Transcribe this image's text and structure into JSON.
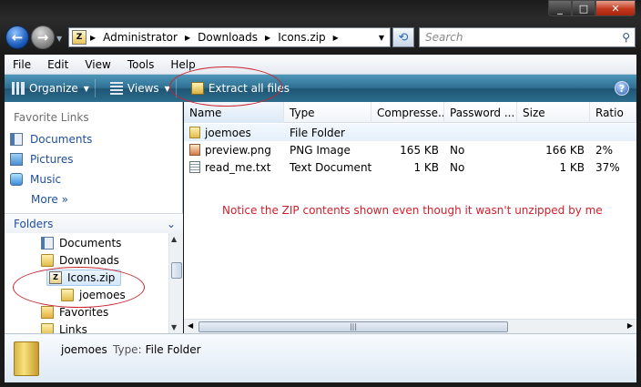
{
  "window": {
    "minimize": "_",
    "maximize": "□",
    "close": "✕"
  },
  "address": {
    "crumbs": [
      "Administrator",
      "Downloads",
      "Icons.zip"
    ],
    "search_placeholder": "Search"
  },
  "menu": [
    "File",
    "Edit",
    "View",
    "Tools",
    "Help"
  ],
  "commands": {
    "organize": "Organize",
    "views": "Views",
    "extract": "Extract all files",
    "help": "?"
  },
  "nav": {
    "favorite_title": "Favorite Links",
    "favorites": [
      "Documents",
      "Pictures",
      "Music"
    ],
    "more": "More",
    "folders_title": "Folders",
    "tree": [
      "Documents",
      "Downloads",
      "Icons.zip",
      "joemoes",
      "Favorites",
      "Links"
    ]
  },
  "columns": [
    "Name",
    "Type",
    "Compresse...",
    "Password ...",
    "Size",
    "Ratio"
  ],
  "files": [
    {
      "name": "joemoes",
      "type": "File Folder",
      "compressed": "",
      "password": "",
      "size": "",
      "ratio": ""
    },
    {
      "name": "preview.png",
      "type": "PNG Image",
      "compressed": "165 KB",
      "password": "No",
      "size": "166 KB",
      "ratio": "2%"
    },
    {
      "name": "read_me.txt",
      "type": "Text Document",
      "compressed": "1 KB",
      "password": "No",
      "size": "1 KB",
      "ratio": "37%"
    }
  ],
  "annotation_note": "Notice the ZIP contents shown even though it wasn't unzipped by me",
  "details": {
    "name": "joemoes",
    "type_label": "Type:",
    "type_value": "File Folder"
  },
  "colors": {
    "annotation": "#c8232f",
    "link": "#1f4e9c",
    "note": "#d01f2b"
  }
}
